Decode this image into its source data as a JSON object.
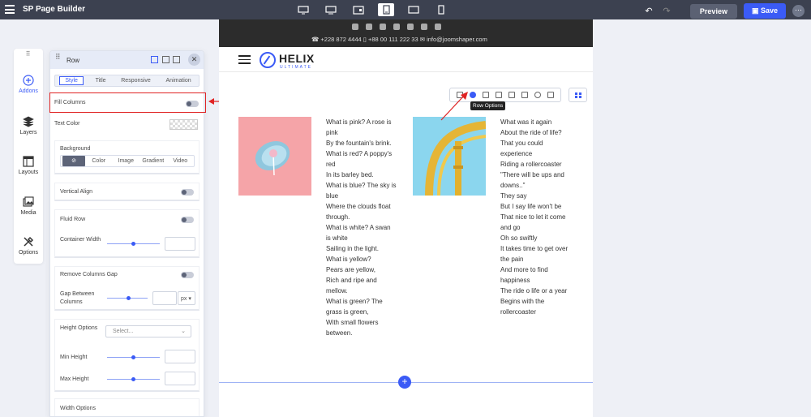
{
  "app": {
    "title": "SP Page Builder"
  },
  "toolbar": {
    "preview_label": "Preview",
    "save_label": "Save",
    "more_label": "⋯",
    "devices": [
      "desktop-large-icon",
      "desktop-icon",
      "laptop-icon",
      "tablet-icon",
      "tablet-landscape-icon",
      "mobile-icon"
    ]
  },
  "sidebar": {
    "items": [
      {
        "label": "Addons",
        "icon": "plus-circle-icon"
      },
      {
        "label": "Layers",
        "icon": "layers-icon"
      },
      {
        "label": "Layouts",
        "icon": "layout-icon"
      },
      {
        "label": "Media",
        "icon": "media-icon"
      },
      {
        "label": "Options",
        "icon": "tools-icon"
      }
    ]
  },
  "panel": {
    "title": "Row",
    "close": "✕",
    "tabs": [
      "Style",
      "Title",
      "Responsive",
      "Animation"
    ],
    "fill_columns": "Fill Columns",
    "text_color": "Text Color",
    "background": {
      "label": "Background",
      "options": [
        "⊘",
        "Color",
        "Image",
        "Gradient",
        "Video"
      ]
    },
    "vertical_align": "Vertical Align",
    "fluid_row": "Fluid Row",
    "container_width": "Container Width",
    "remove_gap": "Remove Columns Gap",
    "gap_between": "Gap Between Columns",
    "gap_unit": "px",
    "height_options": "Height Options",
    "height_select": "Select...",
    "min_height": "Min Height",
    "max_height": "Max Height",
    "width_options": "Width Options"
  },
  "site": {
    "contact": "☎ +228 872 4444   ▯ +88 00 111 222 33   ✉ info@joomshaper.com",
    "logo": "HELIX",
    "logo_sub": "ULTIMATE",
    "tooltip": "Row Options",
    "add": "+",
    "poem1": "What is pink? A rose is\npink\nBy the fountain's brink.\nWhat is red? A poppy's\nred\nIn its barley bed.\nWhat is blue? The sky is\nblue\nWhere the clouds float\nthrough.\nWhat is white? A swan\nis white\nSailing in the light.\nWhat is yellow?\nPears are yellow,\nRich and ripe and\nmellow.\nWhat is green? The\ngrass is green,\nWith small flowers\nbetween.",
    "poem2": "What was it again\nAbout the ride of life?\nThat you could\nexperience\nRiding a rollercoaster\n\"There will be ups and\ndowns..\"\nThey say\nBut I say life won't be\nThat nice to let it come\nand go\nOh so swiftly\nIt takes time to get over\nthe pain\nAnd more to find\nhappiness\nThe ride o life or a year\nBegins with the\nrollercoaster"
  },
  "colors": {
    "accent": "#3b5bf6",
    "topbar": "#3c4150",
    "highlight": "#e02424"
  }
}
